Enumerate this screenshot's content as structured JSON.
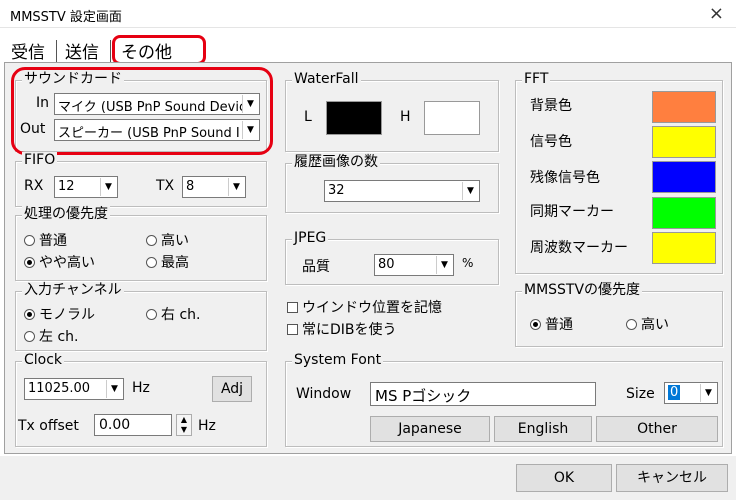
{
  "window": {
    "title": "MMSSTV 設定画面",
    "close": "×"
  },
  "tabs": [
    {
      "label": "受信"
    },
    {
      "label": "送信"
    },
    {
      "label": "その他",
      "active": true
    }
  ],
  "sound_card": {
    "legend": "サウンドカード",
    "in_label": "In",
    "in_value": "マイク (USB PnP Sound Devic",
    "out_label": "Out",
    "out_value": "スピーカー (USB PnP Sound I"
  },
  "fifo": {
    "legend": "FIFO",
    "rx_label": "RX",
    "rx_value": "12",
    "tx_label": "TX",
    "tx_value": "8"
  },
  "priority": {
    "legend": "処理の優先度",
    "options": [
      "普通",
      "高い",
      "やや高い",
      "最高"
    ],
    "selected": "やや高い"
  },
  "channel": {
    "legend": "入力チャンネル",
    "options": [
      "モノラル",
      "右 ch.",
      "左 ch."
    ],
    "selected": "モノラル"
  },
  "clock": {
    "legend": "Clock",
    "value": "11025.00",
    "unit": "Hz",
    "adj": "Adj",
    "tx_offset_label": "Tx offset",
    "tx_offset_value": "0.00",
    "tx_offset_unit": "Hz"
  },
  "waterfall": {
    "legend": "WaterFall",
    "l_label": "L",
    "h_label": "H",
    "l_color": "#000000",
    "h_color": "#ffffff"
  },
  "history": {
    "legend": "履歴画像の数",
    "value": "32"
  },
  "jpeg": {
    "legend": "JPEG",
    "quality_label": "品質",
    "quality_value": "80",
    "unit": "%"
  },
  "checks": {
    "window_pos": "ウインドウ位置を記憶",
    "dib": "常にDIBを使う"
  },
  "fft": {
    "legend": "FFT",
    "items": [
      {
        "label": "背景色",
        "color": "#ff7f3f"
      },
      {
        "label": "信号色",
        "color": "#ffff00"
      },
      {
        "label": "残像信号色",
        "color": "#0000ff"
      },
      {
        "label": "同期マーカー",
        "color": "#00ff00"
      },
      {
        "label": "周波数マーカー",
        "color": "#ffff00"
      }
    ]
  },
  "mmsstv_priority": {
    "legend": "MMSSTVの優先度",
    "options": [
      "普通",
      "高い"
    ],
    "selected": "普通"
  },
  "system_font": {
    "legend": "System Font",
    "window_label": "Window",
    "font_value": "MS Pゴシック",
    "size_label": "Size",
    "size_value": "0",
    "buttons": [
      "Japanese",
      "English",
      "Other"
    ]
  },
  "footer": {
    "ok": "OK",
    "cancel": "キャンセル"
  },
  "highlight_color": "#e60012"
}
